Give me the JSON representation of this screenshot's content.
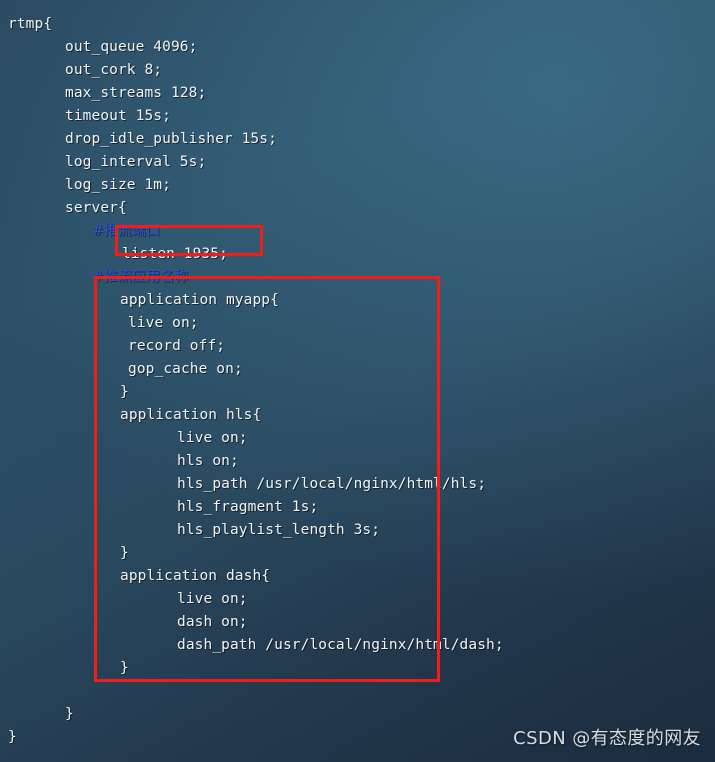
{
  "editor": {
    "language": "nginx-conf",
    "font_color": "#f2f4f5",
    "comment_color": "#2f4fd0",
    "background_gradient_from": "#2c5068",
    "background_gradient_to": "#1b2c3e",
    "lines": [
      {
        "indent": 8,
        "text": "rtmp{",
        "kind": "code"
      },
      {
        "indent": 65,
        "text": "out_queue 4096;",
        "kind": "code"
      },
      {
        "indent": 65,
        "text": "out_cork 8;",
        "kind": "code"
      },
      {
        "indent": 65,
        "text": "max_streams 128;",
        "kind": "code"
      },
      {
        "indent": 65,
        "text": "timeout 15s;",
        "kind": "code"
      },
      {
        "indent": 65,
        "text": "drop_idle_publisher 15s;",
        "kind": "code"
      },
      {
        "indent": 65,
        "text": "log_interval 5s;",
        "kind": "code"
      },
      {
        "indent": 65,
        "text": "log_size 1m;",
        "kind": "code"
      },
      {
        "indent": 65,
        "text": "server{",
        "kind": "code"
      },
      {
        "indent": 92,
        "text": "#推流端口",
        "kind": "comment"
      },
      {
        "indent": 122,
        "text": "listen 1935;",
        "kind": "code"
      },
      {
        "indent": 92,
        "text": "#推流应用名称",
        "kind": "comment"
      },
      {
        "indent": 120,
        "text": "application myapp{",
        "kind": "code"
      },
      {
        "indent": 128,
        "text": "live on;",
        "kind": "code"
      },
      {
        "indent": 128,
        "text": "record off;",
        "kind": "code"
      },
      {
        "indent": 128,
        "text": "gop_cache on;",
        "kind": "code"
      },
      {
        "indent": 120,
        "text": "}",
        "kind": "code"
      },
      {
        "indent": 120,
        "text": "application hls{",
        "kind": "code"
      },
      {
        "indent": 177,
        "text": "live on;",
        "kind": "code"
      },
      {
        "indent": 177,
        "text": "hls on;",
        "kind": "code"
      },
      {
        "indent": 177,
        "text": "hls_path /usr/local/nginx/html/hls;",
        "kind": "code"
      },
      {
        "indent": 177,
        "text": "hls_fragment 1s;",
        "kind": "code"
      },
      {
        "indent": 177,
        "text": "hls_playlist_length 3s;",
        "kind": "code"
      },
      {
        "indent": 120,
        "text": "}",
        "kind": "code"
      },
      {
        "indent": 120,
        "text": "application dash{",
        "kind": "code"
      },
      {
        "indent": 177,
        "text": "live on;",
        "kind": "code"
      },
      {
        "indent": 177,
        "text": "dash on;",
        "kind": "code"
      },
      {
        "indent": 177,
        "text": "dash_path /usr/local/nginx/html/dash;",
        "kind": "code"
      },
      {
        "indent": 120,
        "text": "}",
        "kind": "code"
      },
      {
        "indent": 0,
        "text": "",
        "kind": "code"
      },
      {
        "indent": 65,
        "text": "}",
        "kind": "code"
      },
      {
        "indent": 8,
        "text": "}",
        "kind": "code"
      }
    ]
  },
  "annotations": {
    "color": "#ef1f18",
    "boxes": [
      {
        "id": "box-listen",
        "label": "listen-port-highlight"
      },
      {
        "id": "box-apps",
        "label": "rtmp-applications-highlight"
      }
    ]
  },
  "watermark": {
    "text": "CSDN @有态度的网友"
  }
}
